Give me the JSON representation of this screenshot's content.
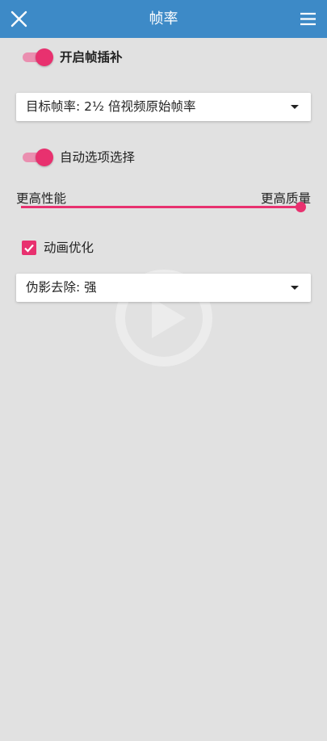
{
  "appbar": {
    "title": "帧率",
    "close_icon": "close-icon",
    "menu_icon": "menu-icon",
    "color": "#3d8ac7"
  },
  "settings": {
    "frame_interp": {
      "label": "开启帧插补",
      "on": true
    },
    "target_fps": {
      "value": "目标帧率: 2½ 倍视频原始帧率"
    },
    "auto_select": {
      "label": "自动选项选择",
      "on": true
    },
    "quality_slider": {
      "min_label": "更高性能",
      "max_label": "更高质量",
      "value": 1.0
    },
    "anim_opt": {
      "label": "动画优化",
      "checked": true
    },
    "artifact_removal": {
      "value": "伪影去除: 强"
    }
  },
  "accent_color": "#e8316f",
  "background_color": "#e1e1e1"
}
